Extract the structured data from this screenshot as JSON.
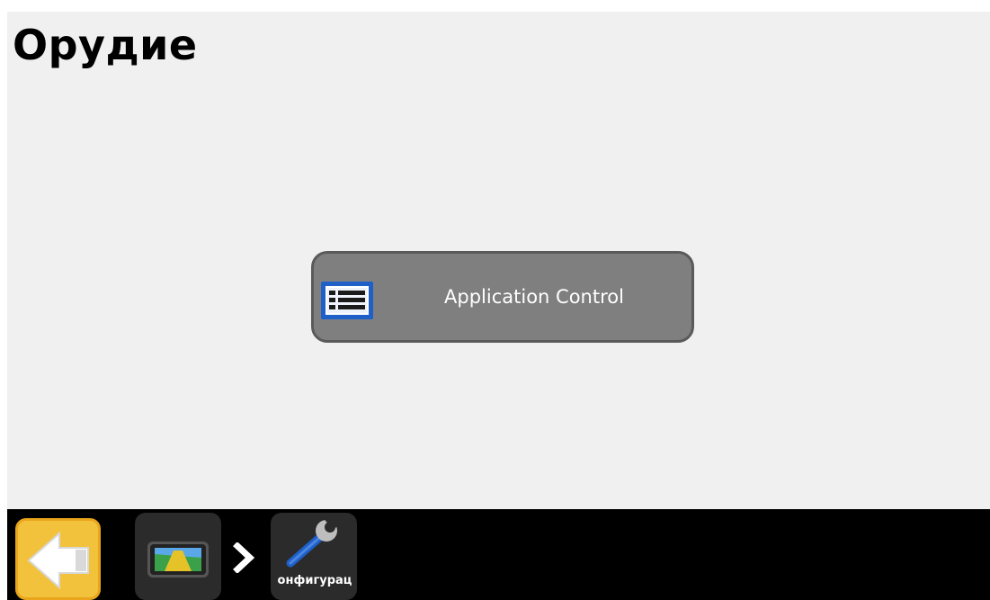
{
  "page": {
    "title": "Орудие"
  },
  "main": {
    "application_button": {
      "label": "Application Control",
      "icon": "list-icon"
    }
  },
  "bottom_bar": {
    "back_button": {
      "icon": "back-arrow-icon"
    },
    "breadcrumbs": [
      {
        "icon": "display-icon",
        "label": ""
      },
      {
        "separator_icon": "chevron-right-icon"
      },
      {
        "icon": "wrench-icon",
        "label": "онфигурац"
      }
    ]
  },
  "colors": {
    "background": "#f0f0f0",
    "button": "#7f7f7f",
    "bar": "#000000",
    "back_button": "#f2c23c",
    "icon_blue": "#1f5fc8"
  }
}
